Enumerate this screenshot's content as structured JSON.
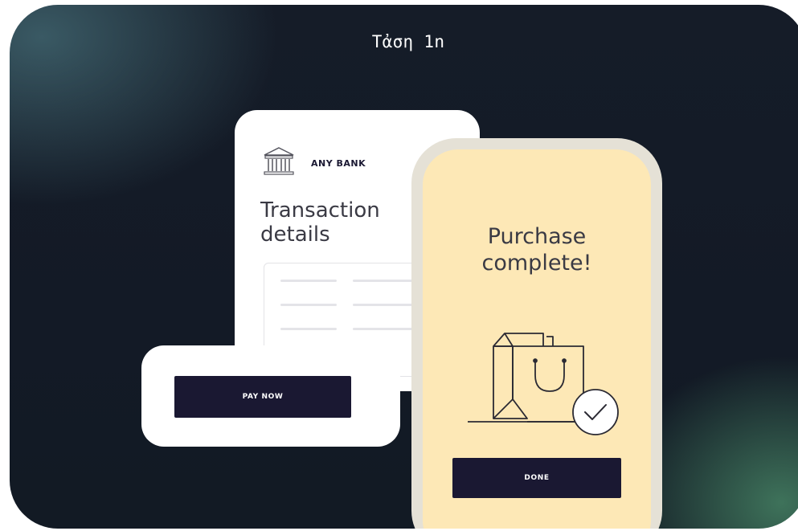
{
  "header": {
    "title": "Tἀση 1n"
  },
  "bank_card": {
    "bank_name": "ANY BANK",
    "title_line1": "Transaction",
    "title_line2": "details"
  },
  "pay_card": {
    "button_label": "PAY NOW"
  },
  "phone": {
    "title_line1": "Purchase",
    "title_line2": "complete!",
    "button_label": "DONE"
  },
  "icons": [
    "bank-icon",
    "shopping-bag-icon",
    "checkmark-icon"
  ],
  "colors": {
    "background": "#131a26",
    "button": "#1a1832",
    "phone_screen": "#fde8b6",
    "card": "#ffffff"
  }
}
